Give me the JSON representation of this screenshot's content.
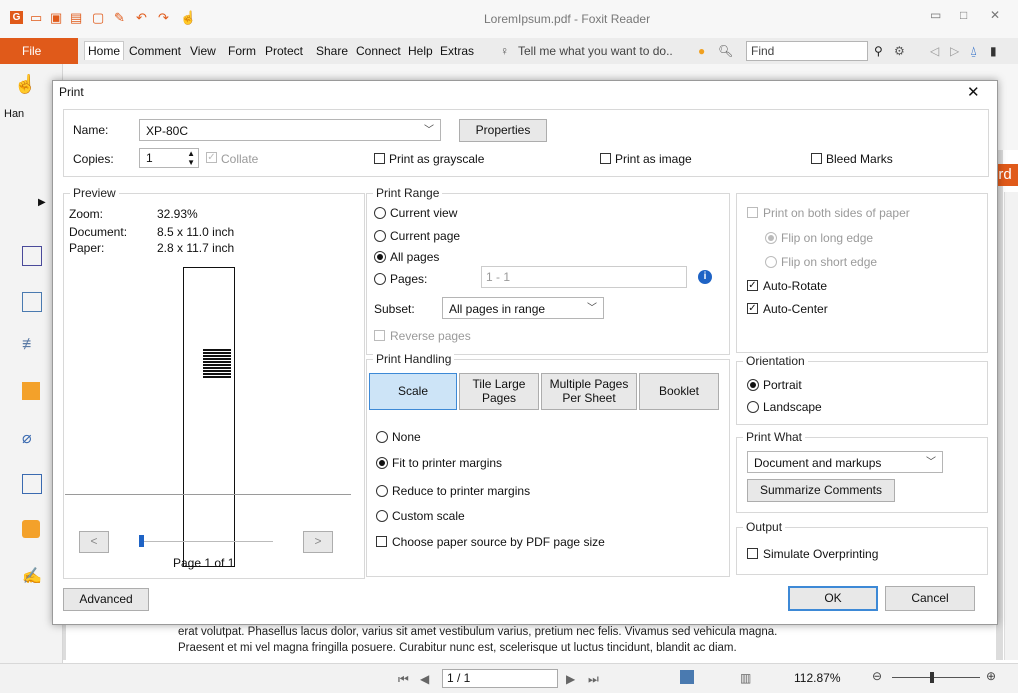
{
  "app": {
    "window_title": "LoremIpsum.pdf - Foxit Reader",
    "menu": [
      "File",
      "Home",
      "Comment",
      "View",
      "Form",
      "Protect",
      "Share",
      "Connect",
      "Help",
      "Extras"
    ],
    "tell_me": "Tell me what you want to do..",
    "find_placeholder": "Find",
    "left_tool_label": "Han",
    "doc_text_lines": [
      "erat volutpat. Phasellus lacus dolor, varius sit amet vestibulum varius, pretium nec felis. Vivamus sed vehicula magna.",
      "Praesent et mi vel magna fringilla posuere. Curabitur nunc est, scelerisque ut luctus tincidunt, blandit ac diam."
    ],
    "right_tab_text": "ord",
    "status": {
      "page": "1 / 1",
      "zoom": "112.87%"
    },
    "accent_color": "#e05a1a"
  },
  "dialog": {
    "title": "Print",
    "printer": {
      "name_label": "Name:",
      "name_value": "XP-80C",
      "properties_label": "Properties",
      "copies_label": "Copies:",
      "copies_value": "1",
      "collate_label": "Collate",
      "grayscale_label": "Print as grayscale",
      "as_image_label": "Print as image",
      "bleed_label": "Bleed Marks"
    },
    "preview": {
      "group_label": "Preview",
      "zoom_label": "Zoom:",
      "zoom_value": "32.93%",
      "document_label": "Document:",
      "document_value": "8.5 x 11.0 inch",
      "paper_label": "Paper:",
      "paper_value": "2.8 x 11.7 inch",
      "prev": "<",
      "next": ">",
      "page_label": "Page 1 of 1"
    },
    "range": {
      "group_label": "Print Range",
      "current_view": "Current view",
      "current_page": "Current page",
      "all_pages": "All pages",
      "pages_label": "Pages:",
      "pages_value": "1 - 1",
      "subset_label": "Subset:",
      "subset_value": "All pages in range",
      "reverse_label": "Reverse pages"
    },
    "handling": {
      "group_label": "Print Handling",
      "scale": "Scale",
      "tile": "Tile Large Pages",
      "multiple": "Multiple Pages Per Sheet",
      "booklet": "Booklet",
      "none": "None",
      "fit": "Fit to printer margins",
      "reduce": "Reduce to printer margins",
      "custom": "Custom scale",
      "paper_source": "Choose paper source by PDF page size"
    },
    "duplex": {
      "both_sides": "Print on both sides of paper",
      "long_edge": "Flip on long edge",
      "short_edge": "Flip on short edge",
      "auto_rotate": "Auto-Rotate",
      "auto_center": "Auto-Center"
    },
    "orientation": {
      "group_label": "Orientation",
      "portrait": "Portrait",
      "landscape": "Landscape"
    },
    "print_what": {
      "group_label": "Print What",
      "value": "Document and markups",
      "summarize": "Summarize Comments"
    },
    "output": {
      "group_label": "Output",
      "simulate": "Simulate Overprinting"
    },
    "advanced": "Advanced",
    "ok": "OK",
    "cancel": "Cancel"
  }
}
